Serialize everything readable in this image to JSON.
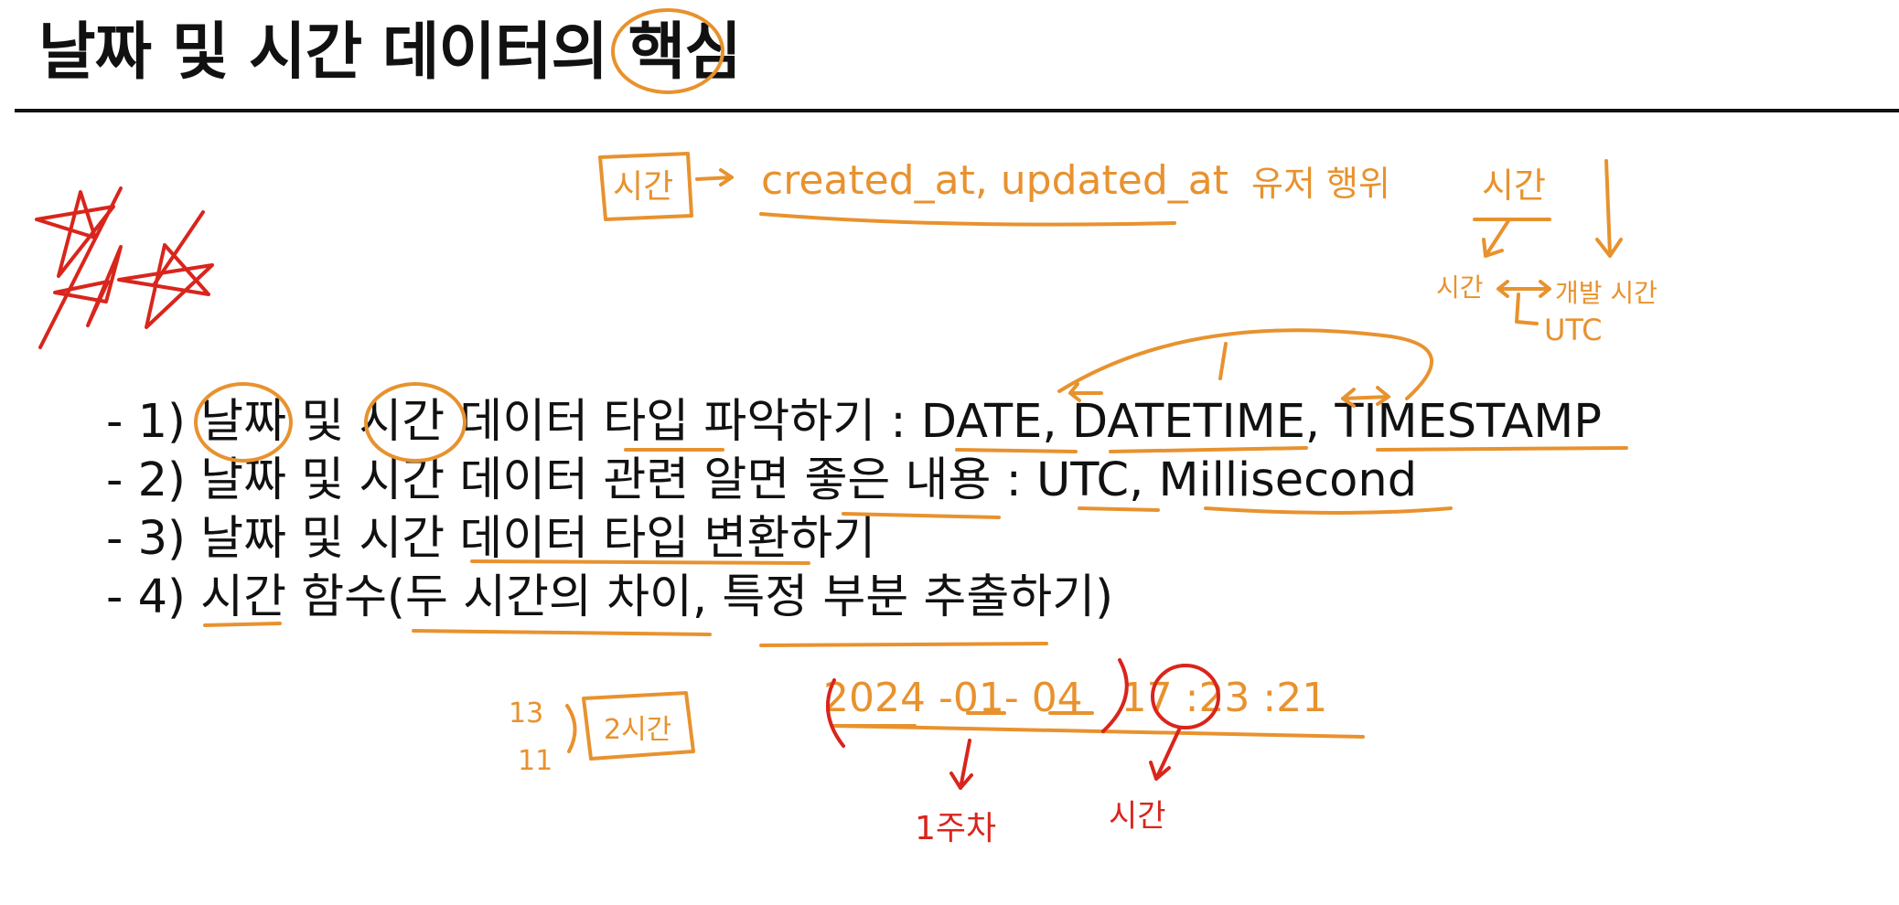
{
  "title": "날짜 및 시간 데이터의 핵심",
  "bullets": [
    "- 1) 날짜 및 시간 데이터 타입 파악하기 : DATE, DATETIME, TIMESTAMP",
    "- 2) 날짜 및 시간 데이터 관련 알면 좋은 내용 : UTC, Millisecond",
    "- 3) 날짜 및 시간 데이터 타입 변환하기",
    "- 4) 시간 함수(두 시간의 차이, 특정 부분 추출하기)"
  ],
  "annotations": {
    "time_box": "시간",
    "fields": "created_at, updated_at",
    "user_action": "유저 행위",
    "user_action_time": "시간",
    "server_time": "시간",
    "dev_time": "개발 시간",
    "utc": "UTC",
    "hours_13": "13",
    "hours_11": "11",
    "two_hours": "2시간",
    "datetime_example": "2024 -01- 04   17 :23 :21",
    "first_part": "1주차",
    "hour_part": "시간"
  },
  "colors": {
    "text": "#111111",
    "orange_ink": "#e8922e",
    "red_ink": "#d9251c"
  }
}
